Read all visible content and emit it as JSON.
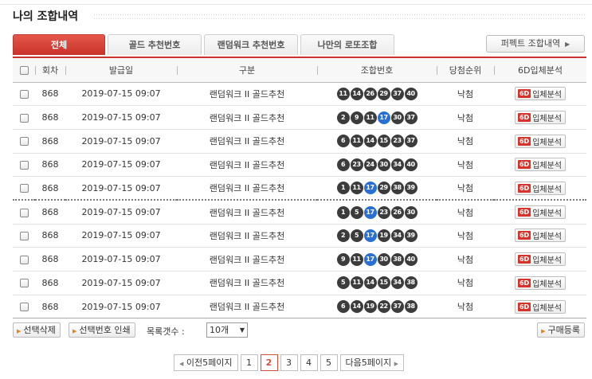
{
  "page": {
    "title": "나의 조합내역"
  },
  "tabs": [
    {
      "label": "전체",
      "active": true
    },
    {
      "label": "골드 추천번호",
      "active": false
    },
    {
      "label": "랜덤워크 추천번호",
      "active": false
    },
    {
      "label": "나만의 로또조합",
      "active": false
    }
  ],
  "perfect_button": {
    "label": "퍼펙트 조합내역",
    "icon": "chevron-right-icon"
  },
  "columns": [
    "회차",
    "발급일",
    "구분",
    "조합번호",
    "당첨순위",
    "6D입체분석"
  ],
  "analysis": {
    "badge": "6D",
    "label": "입체분석"
  },
  "accent_color": "#c9322a",
  "highlight_ball_color": "#2a6fd3",
  "rows": [
    {
      "round": "868",
      "date": "2019-07-15 09:07",
      "type": "랜덤워크 II 골드추천",
      "numbers": [
        11,
        14,
        26,
        29,
        37,
        40
      ],
      "rank": "낙첨"
    },
    {
      "round": "868",
      "date": "2019-07-15 09:07",
      "type": "랜덤워크 II 골드추천",
      "numbers": [
        2,
        9,
        11,
        17,
        30,
        37
      ],
      "rank": "낙첨"
    },
    {
      "round": "868",
      "date": "2019-07-15 09:07",
      "type": "랜덤워크 II 골드추천",
      "numbers": [
        6,
        11,
        14,
        15,
        23,
        37
      ],
      "rank": "낙첨"
    },
    {
      "round": "868",
      "date": "2019-07-15 09:07",
      "type": "랜덤워크 II 골드추천",
      "numbers": [
        6,
        23,
        24,
        30,
        34,
        40
      ],
      "rank": "낙첨"
    },
    {
      "round": "868",
      "date": "2019-07-15 09:07",
      "type": "랜덤워크 II 골드추천",
      "numbers": [
        1,
        11,
        17,
        29,
        38,
        39
      ],
      "rank": "낙첨"
    },
    {
      "round": "868",
      "date": "2019-07-15 09:07",
      "type": "랜덤워크 II 골드추천",
      "numbers": [
        1,
        5,
        17,
        23,
        26,
        30
      ],
      "rank": "낙첨"
    },
    {
      "round": "868",
      "date": "2019-07-15 09:07",
      "type": "랜덤워크 II 골드추천",
      "numbers": [
        2,
        5,
        17,
        19,
        34,
        39
      ],
      "rank": "낙첨"
    },
    {
      "round": "868",
      "date": "2019-07-15 09:07",
      "type": "랜덤워크 II 골드추천",
      "numbers": [
        9,
        11,
        17,
        30,
        38,
        40
      ],
      "rank": "낙첨"
    },
    {
      "round": "868",
      "date": "2019-07-15 09:07",
      "type": "랜덤워크 II 골드추천",
      "numbers": [
        5,
        11,
        14,
        15,
        34,
        38
      ],
      "rank": "낙첨"
    },
    {
      "round": "868",
      "date": "2019-07-15 09:07",
      "type": "랜덤워크 II 골드추천",
      "numbers": [
        6,
        14,
        19,
        22,
        37,
        38
      ],
      "rank": "낙첨"
    }
  ],
  "highlighted_number": 17,
  "bottom": {
    "delete_label": "선택삭제",
    "print_label": "선택번호 인쇄",
    "count_label": "목록갯수 :",
    "count_value": "10개",
    "purchase_label": "구매등록"
  },
  "pager": {
    "prev_label": "이전5페이지",
    "next_label": "다음5페이지",
    "pages": [
      "1",
      "2",
      "3",
      "4",
      "5"
    ],
    "current": "2"
  }
}
